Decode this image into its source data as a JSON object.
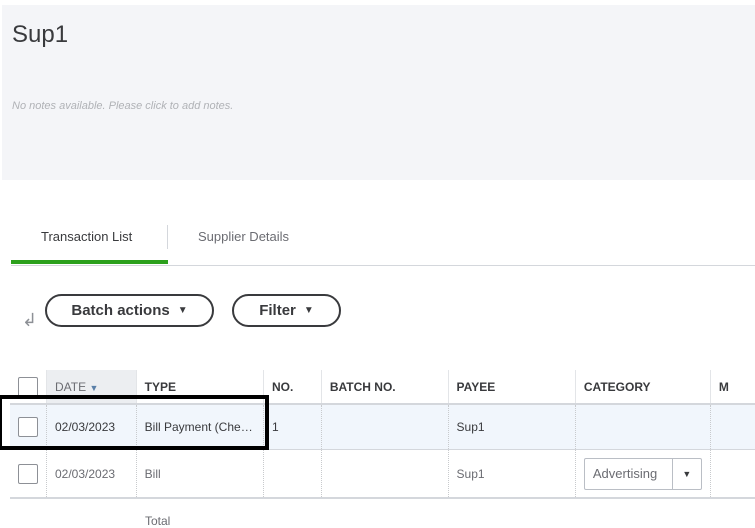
{
  "header": {
    "title": "Sup1",
    "notes_placeholder": "No notes available. Please click to add notes."
  },
  "tabs": [
    {
      "label": "Transaction List",
      "active": true
    },
    {
      "label": "Supplier Details",
      "active": false
    }
  ],
  "toolbar": {
    "batch_actions": "Batch actions",
    "filter": "Filter",
    "caret": "▼"
  },
  "table": {
    "columns": [
      "DATE",
      "TYPE",
      "NO.",
      "BATCH NO.",
      "PAYEE",
      "CATEGORY",
      "M"
    ],
    "sort_indicator": "▼",
    "rows": [
      {
        "date": "02/03/2023",
        "type": "Bill Payment (Che…",
        "no": "1",
        "batch": "",
        "payee": "Sup1",
        "category": ""
      },
      {
        "date": "02/03/2023",
        "type": "Bill",
        "no": "",
        "batch": "",
        "payee": "Sup1",
        "category": "Advertising"
      }
    ],
    "total_label": "Total"
  },
  "colors": {
    "accent": "#2ca01c",
    "panel": "#f4f5f8",
    "selected_row": "#f1f6fc"
  }
}
